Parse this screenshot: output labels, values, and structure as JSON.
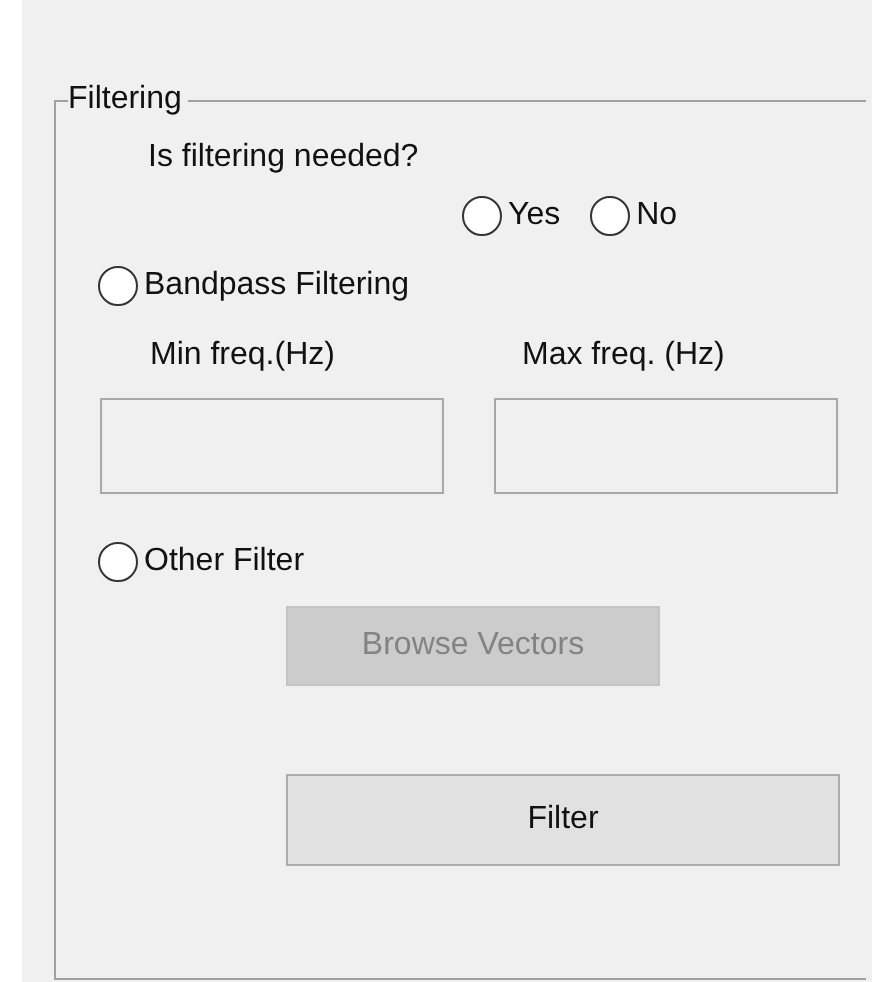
{
  "group": {
    "title": "Filtering"
  },
  "question": "Is filtering needed?",
  "answer_options": [
    {
      "label": "Yes",
      "selected": false
    },
    {
      "label": "No",
      "selected": false
    }
  ],
  "bandpass": {
    "label": "Bandpass Filtering",
    "selected": false
  },
  "fields": [
    {
      "label": "Min freq.(Hz)"
    },
    {
      "label": "Max freq. (Hz)"
    }
  ],
  "other": {
    "label": "Other Filter",
    "selected": false
  },
  "browse_button": {
    "label": "Browse Vectors",
    "disabled": true
  },
  "filter_button": {
    "label": "Filter",
    "disabled": false
  }
}
